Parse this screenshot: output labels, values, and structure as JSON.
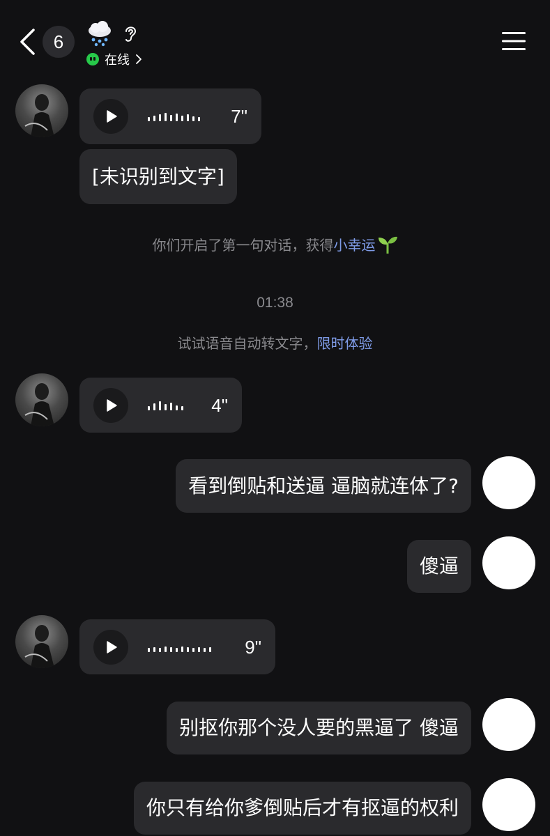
{
  "header": {
    "unread_count": "6",
    "status_label": "在线",
    "icons": [
      "back-icon",
      "weather-snow-cloud-icon",
      "ear-icon",
      "online-dot-icon",
      "chevron-right-icon",
      "menu-icon"
    ]
  },
  "messages": [
    {
      "from": "other",
      "type": "voice",
      "duration": "7\""
    },
    {
      "from": "other",
      "type": "text",
      "text": "[未识别到文字]"
    },
    {
      "type": "system",
      "text": "你们开启了第一句对话，获得",
      "link": "小幸运",
      "emoji": "sprout-icon"
    },
    {
      "type": "time",
      "text": "01:38"
    },
    {
      "type": "system",
      "text": "试试语音自动转文字，",
      "link": "限时体验"
    },
    {
      "from": "other",
      "type": "voice",
      "duration": "4\""
    },
    {
      "from": "self",
      "type": "text",
      "text": "看到倒贴和送逼 逼脑就连体了?"
    },
    {
      "from": "self",
      "type": "text",
      "text": "傻逼"
    },
    {
      "from": "other",
      "type": "voice",
      "duration": "9\""
    },
    {
      "from": "self",
      "type": "text",
      "text": "别抠你那个没人要的黑逼了 傻逼"
    },
    {
      "from": "self",
      "type": "text",
      "text": "你只有给你爹倒贴后才有抠逼的权利"
    }
  ],
  "colors": {
    "background": "#111113",
    "bubble": "#2a2a2d",
    "link": "#7f9ce8",
    "online": "#27c94a",
    "muted_text": "#8a8a8e"
  }
}
